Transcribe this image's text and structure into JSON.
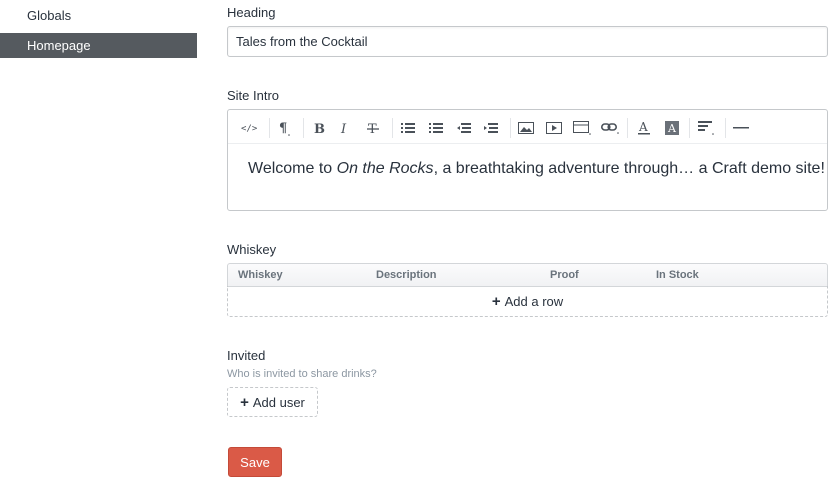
{
  "sidebar": {
    "items": [
      {
        "label": "Globals",
        "active": false
      },
      {
        "label": "Homepage",
        "active": true
      }
    ]
  },
  "heading_field": {
    "label": "Heading",
    "value": "Tales from the Cocktail"
  },
  "site_intro": {
    "label": "Site Intro",
    "toolbar": [
      "html-icon",
      "paragraph-icon",
      "bold-icon",
      "italic-icon",
      "strikethrough-icon",
      "unordered-list-icon",
      "ordered-list-icon",
      "outdent-icon",
      "indent-icon",
      "image-icon",
      "video-icon",
      "table-icon",
      "link-icon",
      "font-color-icon",
      "background-color-icon",
      "alignment-icon",
      "horizontal-rule-icon"
    ],
    "content": {
      "before": "Welcome to ",
      "italic": "On the Rocks",
      "after": ", a breathtaking adventure through… a Craft demo site!"
    }
  },
  "whiskey_field": {
    "label": "Whiskey",
    "columns": [
      "Whiskey",
      "Description",
      "Proof",
      "In Stock"
    ],
    "add_row_label": "Add a row"
  },
  "invited_field": {
    "label": "Invited",
    "instructions": "Who is invited to share drinks?",
    "add_user_label": "Add user"
  },
  "save_label": "Save",
  "colors": {
    "sidebar_active": "#555a5f",
    "save_button": "#da5a47",
    "text": "#29323d",
    "instructions": "#8c97a2"
  }
}
